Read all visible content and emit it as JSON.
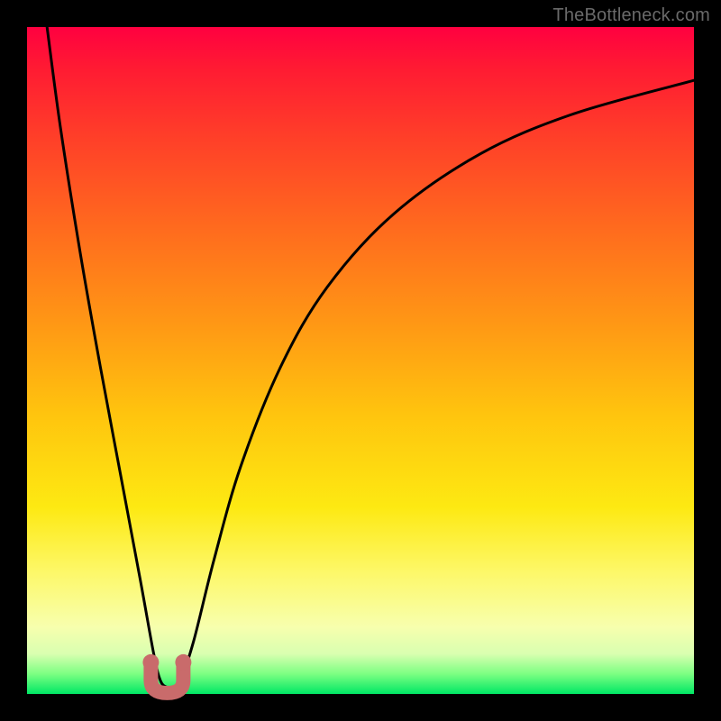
{
  "watermark": "TheBottleneck.com",
  "chart_data": {
    "type": "line",
    "title": "",
    "xlabel": "",
    "ylabel": "",
    "xlim": [
      0,
      100
    ],
    "ylim": [
      0,
      100
    ],
    "series": [
      {
        "name": "bottleneck-curve",
        "x": [
          3,
          5,
          8,
          11,
          14,
          17,
          19,
          20,
          21,
          22,
          23,
          25,
          28,
          32,
          38,
          45,
          55,
          68,
          82,
          100
        ],
        "y": [
          100,
          85,
          66,
          49,
          33,
          17,
          6,
          2,
          1,
          1,
          2,
          8,
          20,
          34,
          49,
          61,
          72,
          81,
          87,
          92
        ]
      }
    ],
    "marker": {
      "name": "optimal-point",
      "x": 21,
      "y": 1.5,
      "color": "#c96b6b"
    },
    "background_gradient": {
      "top": "#ff0040",
      "middle": "#ffd100",
      "bottom": "#00e765"
    }
  },
  "colors": {
    "curve": "#000000",
    "marker": "#c96b6b",
    "frame": "#000000",
    "watermark": "#6a6a6a"
  }
}
